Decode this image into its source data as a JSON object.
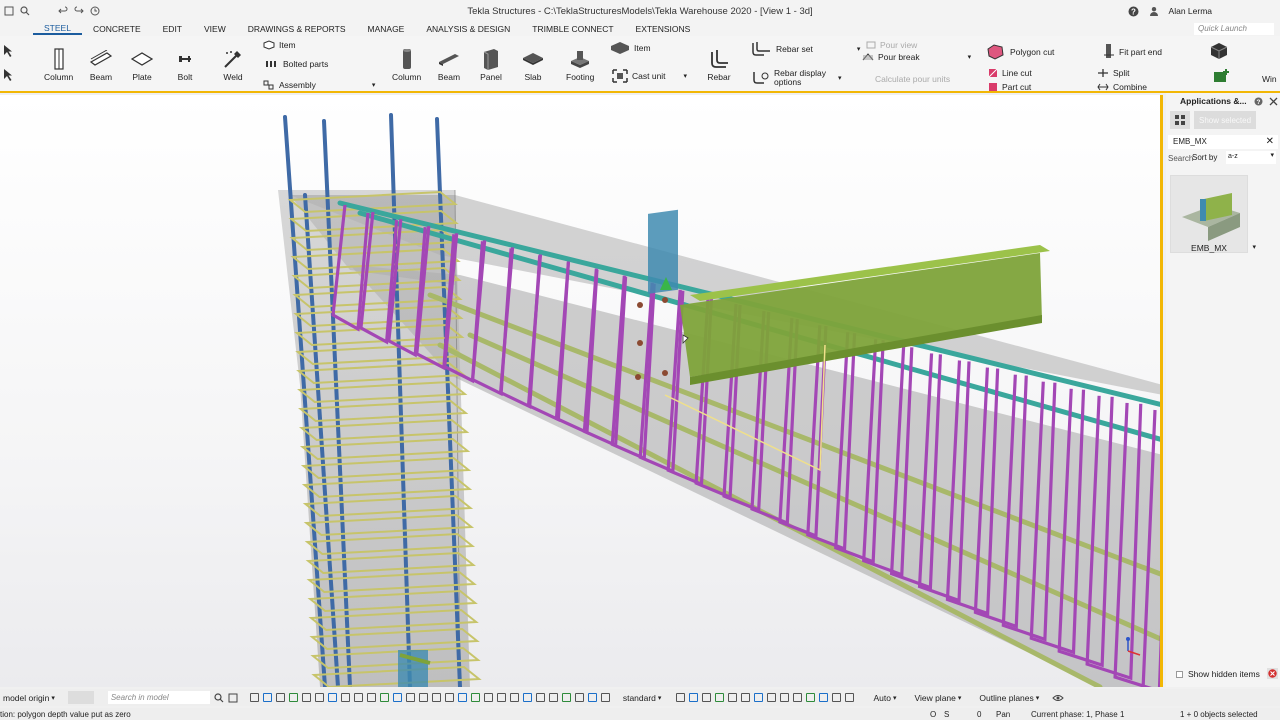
{
  "window": {
    "title": "Tekla Structures - C:\\TeklaStructuresModels\\Tekla Warehouse 2020 - [View 1 - 3d]",
    "user": "Alan Lerma"
  },
  "menu": {
    "items": [
      "STEEL",
      "CONCRETE",
      "EDIT",
      "VIEW",
      "DRAWINGS & REPORTS",
      "MANAGE",
      "ANALYSIS & DESIGN",
      "TRIMBLE CONNECT",
      "EXTENSIONS"
    ],
    "active": "STEEL",
    "quick_launch_placeholder": "Quick Launch"
  },
  "ribbon": {
    "steel": {
      "column": "Column",
      "beam": "Beam",
      "plate": "Plate",
      "bolt": "Bolt",
      "weld": "Weld",
      "item": "Item",
      "bolted_parts": "Bolted parts",
      "assembly": "Assembly"
    },
    "concrete": {
      "column": "Column",
      "beam": "Beam",
      "panel": "Panel",
      "slab": "Slab",
      "footing": "Footing",
      "item": "Item",
      "cast_unit": "Cast unit"
    },
    "rebar": {
      "rebar": "Rebar",
      "rebar_set": "Rebar set",
      "rebar_display": "Rebar display",
      "options": "options"
    },
    "pour": {
      "pour_view": "Pour view",
      "pour_break": "Pour break",
      "calculate": "Calculate pour units"
    },
    "cuts": {
      "polygon_cut": "Polygon cut",
      "line_cut": "Line cut",
      "part_cut": "Part cut",
      "fit_part_end": "Fit part end",
      "split": "Split",
      "combine": "Combine",
      "win": "Win"
    }
  },
  "panel": {
    "title": "Applications &...",
    "show_selected": "Show selected",
    "search_value": "EMB_MX",
    "search_label": "Search",
    "sort_label": "Sort by",
    "sort_value": "a-z",
    "item_label": "EMB_MX",
    "show_hidden": "Show hidden items"
  },
  "bottombar": {
    "origin": "model origin",
    "search_placeholder": "Search in model",
    "standard": "standard",
    "auto": "Auto",
    "view_plane": "View plane",
    "outline_planes": "Outline planes"
  },
  "statusbar": {
    "message": "tion: polygon depth value put as zero",
    "o": "O",
    "s": "S",
    "zero": "0",
    "pan": "Pan",
    "phase": "Current phase: 1, Phase 1",
    "selection": "1 + 0 objects selected"
  },
  "colors": {
    "accent": "#1b5c9e",
    "highlight_border": "#f2b705",
    "stirrup": "#a347b5",
    "longitudinal_bar": "#a8b86a",
    "top_bar": "#3aa79c",
    "column_bar": "#3f6aa6",
    "steel_beam": "#7ea33a",
    "concrete": "#9a9a9a"
  }
}
